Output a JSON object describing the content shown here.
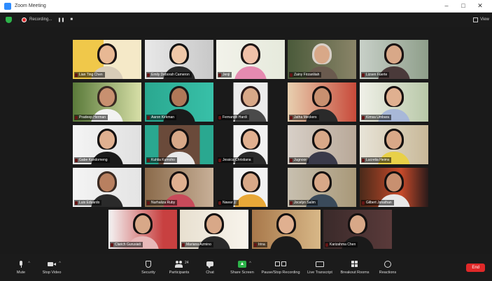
{
  "window": {
    "title": "Zoom Meeting",
    "minimize": "–",
    "maximize": "□",
    "close": "✕"
  },
  "topbar": {
    "recording_label": "Recording...",
    "pause": "❚❚",
    "stop": "■",
    "view_label": "View"
  },
  "participants": [
    {
      "name": "Lian Ting Chen",
      "muted": true
    },
    {
      "name": "Emily Deborah Cameron",
      "muted": true
    },
    {
      "name": "Jenji",
      "muted": true
    },
    {
      "name": "Zainy Firzanliiah",
      "muted": true
    },
    {
      "name": "Lizsen Fuerte",
      "muted": true
    },
    {
      "name": "Pradeep Herman",
      "muted": true
    },
    {
      "name": "Aaron Kirkman",
      "muted": true
    },
    {
      "name": "Fernando Hardi",
      "muted": true
    },
    {
      "name": "Jatha Meckers",
      "muted": true
    },
    {
      "name": "Kimsa Umbara",
      "muted": true
    },
    {
      "name": "Gabe Kandomeng",
      "muted": true
    },
    {
      "name": "Kuhlia Kumoho",
      "muted": true
    },
    {
      "name": "Jessica Christiana",
      "muted": true
    },
    {
      "name": "Jugnoor",
      "muted": true
    },
    {
      "name": "Lucretia Heims",
      "muted": true
    },
    {
      "name": "Luis Eduardo",
      "muted": true
    },
    {
      "name": "Nurhaliza Ruby",
      "muted": true
    },
    {
      "name": "Nawar J.",
      "muted": true
    },
    {
      "name": "Jocelyn Salim",
      "muted": true
    },
    {
      "name": "Gilbert Jonathan",
      "muted": true
    },
    {
      "name": "Clarich Gurusiati",
      "muted": true
    },
    {
      "name": "Mariana Azmino",
      "muted": true
    },
    {
      "name": "Irina",
      "muted": true
    },
    {
      "name": "Karizahma Chen",
      "muted": true
    }
  ],
  "toolbar": {
    "mute": "Mute",
    "stop_video": "Stop Video",
    "security": "Security",
    "participants": "Participants",
    "participants_count": "24",
    "chat": "Chat",
    "share_screen": "Share Screen",
    "pause_recording": "Pause/Stop Recording",
    "live_transcript": "Live Transcript",
    "breakout_rooms": "Breakout Rooms",
    "reactions": "Reactions",
    "end": "End"
  },
  "colors": {
    "accent_green": "#2db44a",
    "end_red": "#e02828",
    "active_speaker": "#c9d23a"
  }
}
